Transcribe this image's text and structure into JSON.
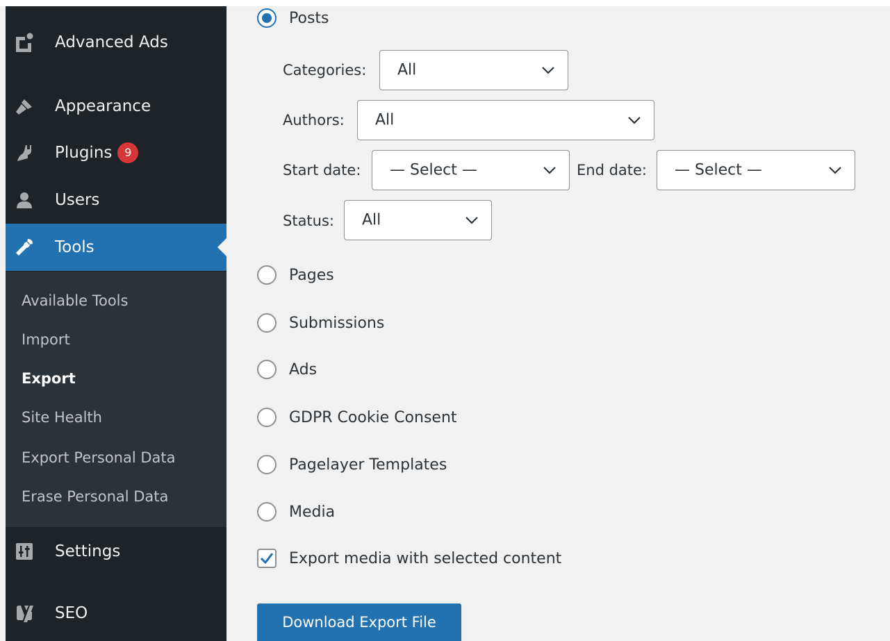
{
  "sidebar": {
    "items": [
      {
        "label": "Advanced Ads",
        "icon": "advanced-ads-icon"
      },
      {
        "label": "Appearance",
        "icon": "paintbrush-icon"
      },
      {
        "label": "Plugins",
        "icon": "plugin-icon",
        "badge": "9"
      },
      {
        "label": "Users",
        "icon": "user-icon"
      },
      {
        "label": "Tools",
        "icon": "wrench-icon",
        "current": true
      },
      {
        "label": "Settings",
        "icon": "settings-sliders-icon"
      },
      {
        "label": "SEO",
        "icon": "yoast-icon"
      }
    ],
    "submenu": [
      {
        "label": "Available Tools"
      },
      {
        "label": "Import"
      },
      {
        "label": "Export",
        "active": true
      },
      {
        "label": "Site Health"
      },
      {
        "label": "Export Personal Data"
      },
      {
        "label": "Erase Personal Data"
      }
    ]
  },
  "export": {
    "content_types": [
      {
        "label": "Posts",
        "checked": true
      },
      {
        "label": "Pages",
        "checked": false
      },
      {
        "label": "Submissions",
        "checked": false
      },
      {
        "label": "Ads",
        "checked": false
      },
      {
        "label": "GDPR Cookie Consent",
        "checked": false
      },
      {
        "label": "Pagelayer Templates",
        "checked": false
      },
      {
        "label": "Media",
        "checked": false
      }
    ],
    "filters": {
      "categories": {
        "label": "Categories:",
        "value": "All"
      },
      "authors": {
        "label": "Authors:",
        "value": "All"
      },
      "start_date": {
        "label": "Start date:",
        "value": "— Select —"
      },
      "end_date": {
        "label": "End date:",
        "value": "— Select —"
      },
      "status": {
        "label": "Status:",
        "value": "All"
      }
    },
    "media_checkbox": {
      "label": "Export media with selected content",
      "checked": true
    },
    "download_button": "Download Export File"
  },
  "colors": {
    "sidebar_bg": "#1d2327",
    "submenu_bg": "#2c3338",
    "accent": "#2271b1",
    "badge": "#d63638",
    "content_bg": "#f1f1f1"
  }
}
